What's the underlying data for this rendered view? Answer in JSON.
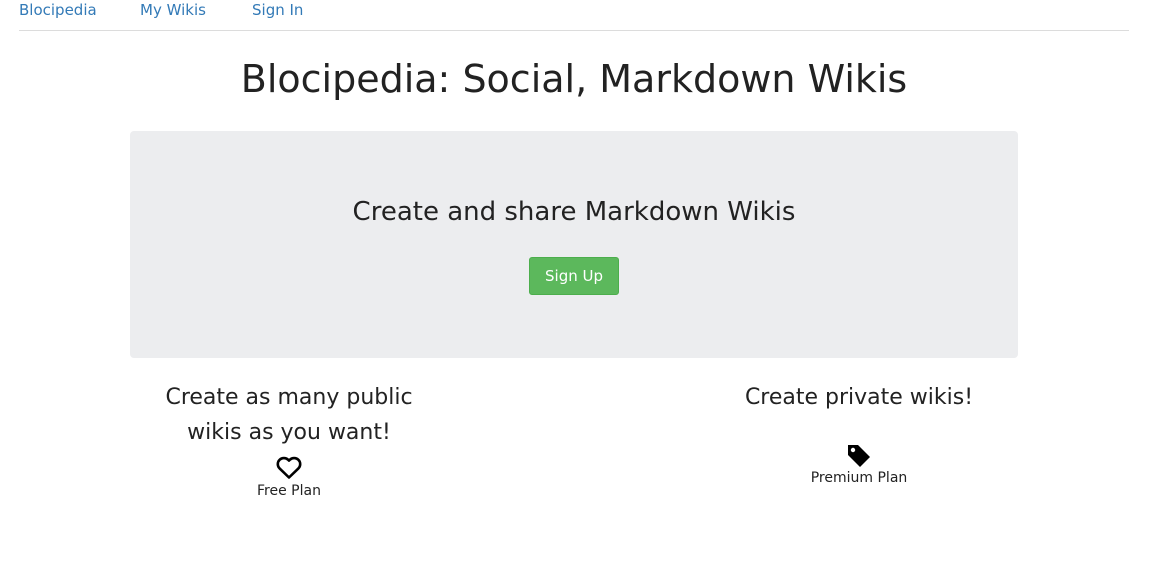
{
  "navbar": {
    "brand": "Blocipedia",
    "my_wikis": "My Wikis",
    "sign_in": "Sign In"
  },
  "page": {
    "title": "Blocipedia: Social, Markdown Wikis"
  },
  "jumbotron": {
    "heading": "Create and share Markdown Wikis",
    "signup_label": "Sign Up"
  },
  "features": {
    "free": {
      "heading": "Create as many public wikis as you want!",
      "icon": "heart-icon",
      "plan": "Free Plan"
    },
    "premium": {
      "heading": "Create private wikis!",
      "icon": "tag-icon",
      "plan": "Premium Plan"
    }
  },
  "colors": {
    "link": "#337ab7",
    "button": "#5cb85c",
    "jumbotron_bg": "#ecedef"
  }
}
